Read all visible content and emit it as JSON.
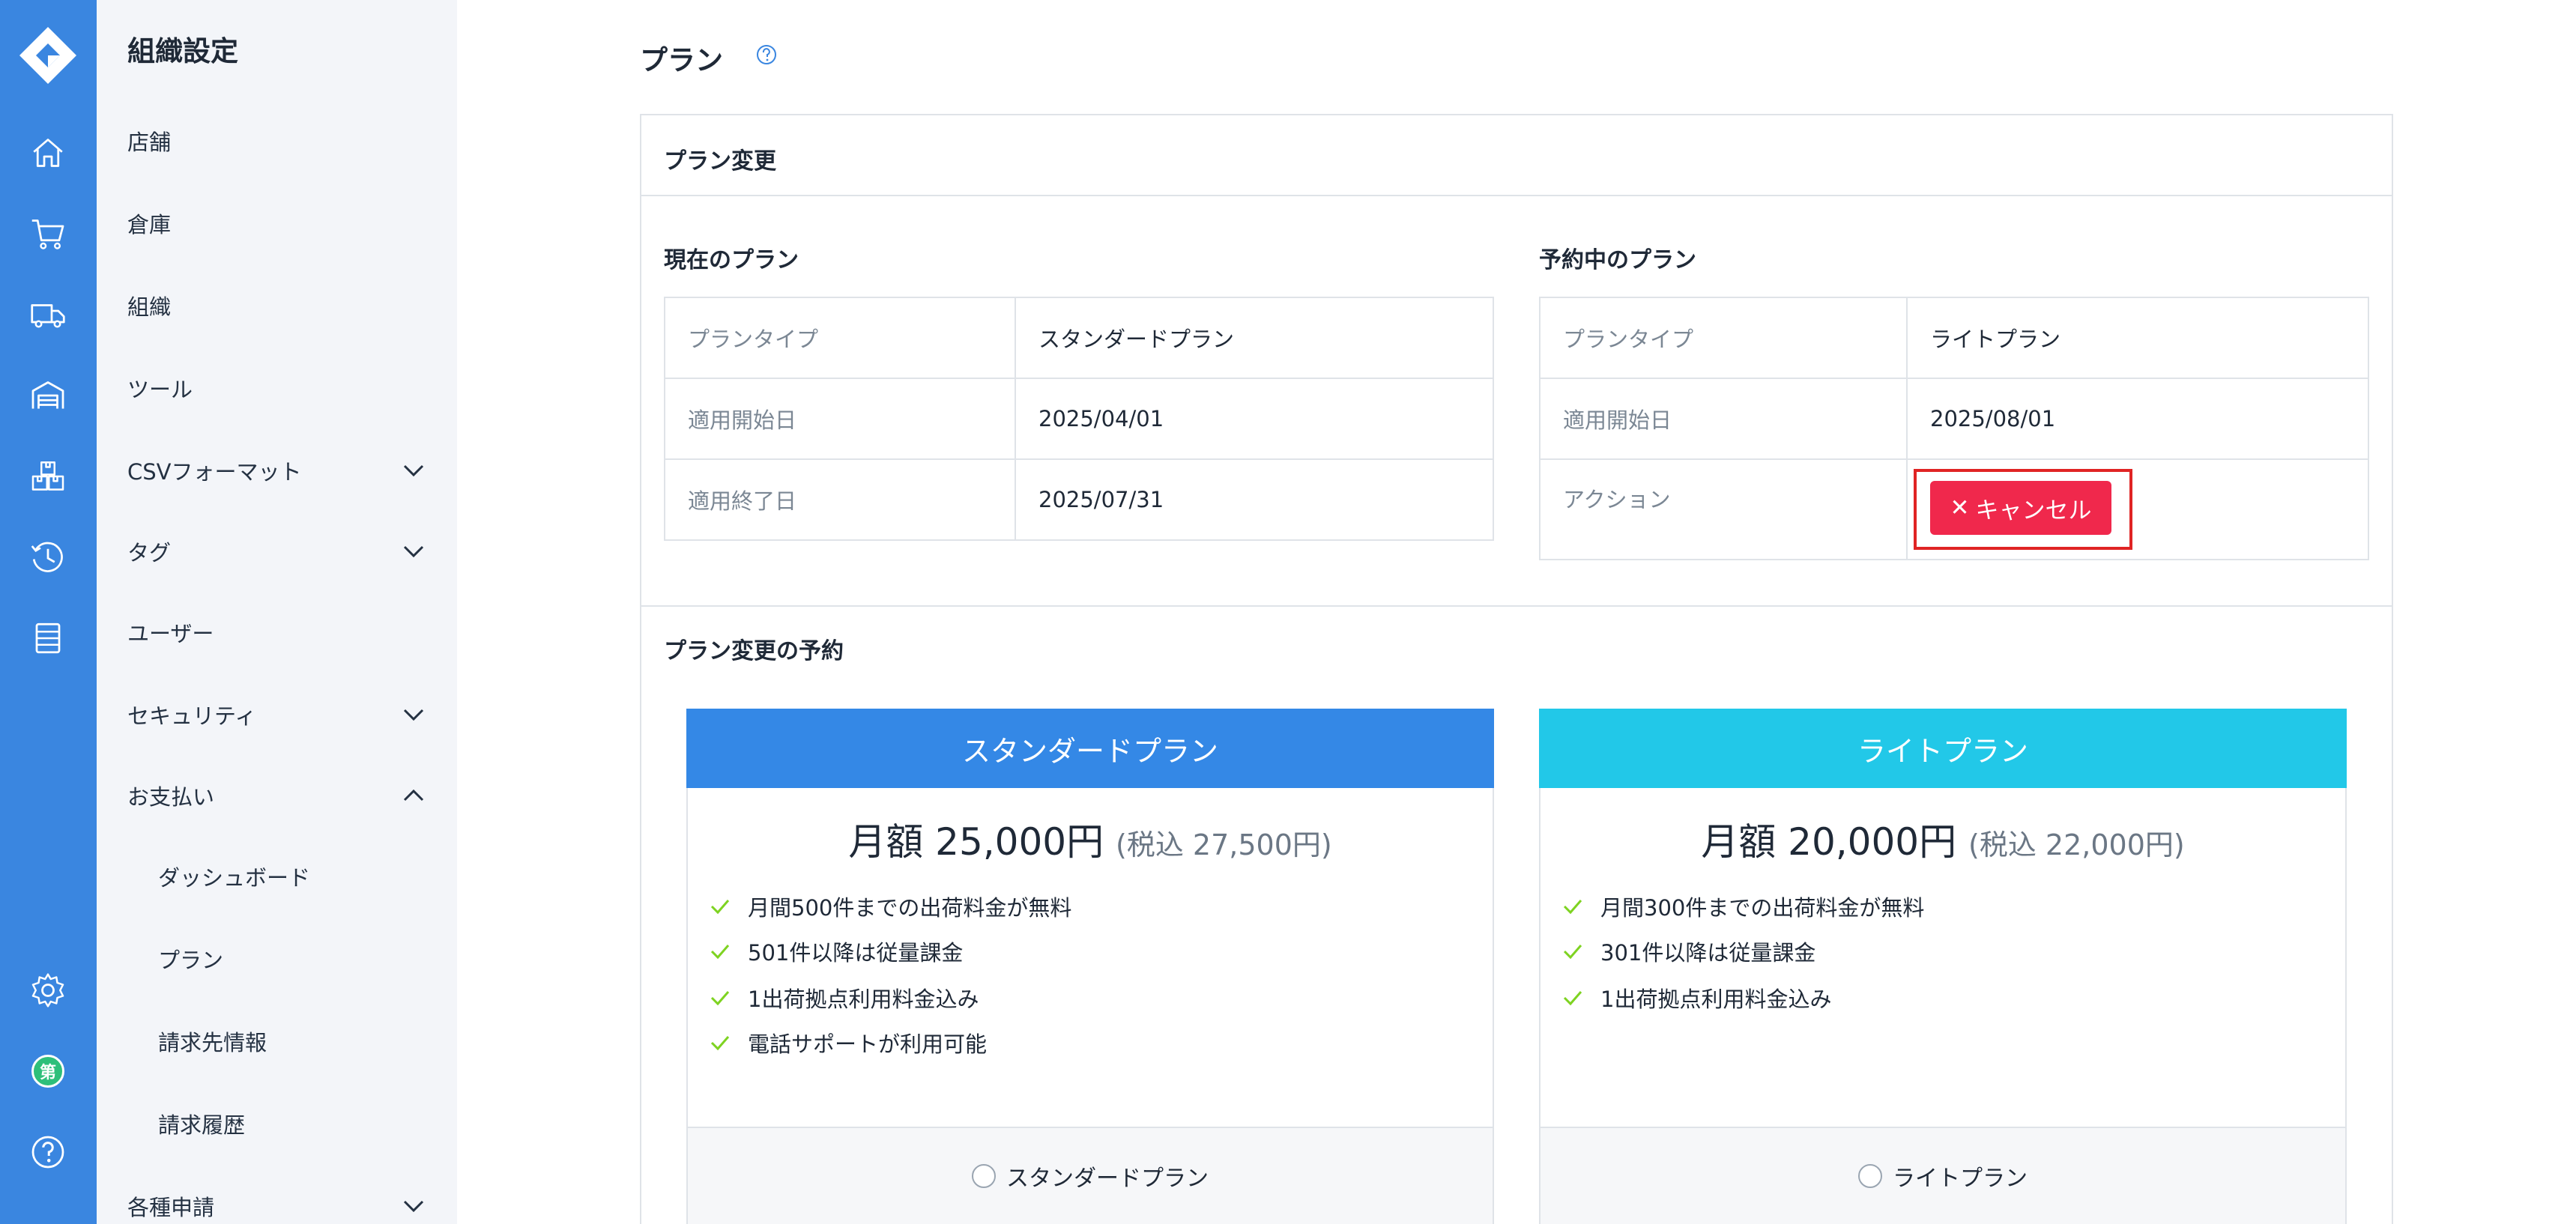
{
  "sidebar": {
    "title": "組織設定",
    "items": [
      {
        "label": "店舗"
      },
      {
        "label": "倉庫"
      },
      {
        "label": "組織"
      },
      {
        "label": "ツール"
      },
      {
        "label": "CSVフォーマット"
      },
      {
        "label": "タグ"
      },
      {
        "label": "ユーザー"
      },
      {
        "label": "セキュリティ"
      },
      {
        "label": "お支払い"
      },
      {
        "label": "ダッシュボード"
      },
      {
        "label": "プラン"
      },
      {
        "label": "請求先情報"
      },
      {
        "label": "請求履歴"
      },
      {
        "label": "各種申請"
      }
    ]
  },
  "rail": {
    "icons": [
      "home-icon",
      "cart-icon",
      "truck-icon",
      "warehouse-icon",
      "boxes-icon",
      "history-icon",
      "list-icon",
      "settings-icon",
      "org-badge-icon",
      "help-icon"
    ],
    "badge_text": "第"
  },
  "page": {
    "title": "プラン"
  },
  "plan_change": {
    "header": "プラン変更",
    "current": {
      "title": "現在のプラン",
      "rows": [
        {
          "key": "プランタイプ",
          "value": "スタンダードプラン"
        },
        {
          "key": "適用開始日",
          "value": "2025/04/01"
        },
        {
          "key": "適用終了日",
          "value": "2025/07/31"
        }
      ]
    },
    "reserved": {
      "title": "予約中のプラン",
      "rows": [
        {
          "key": "プランタイプ",
          "value": "ライトプラン"
        },
        {
          "key": "適用開始日",
          "value": "2025/08/01"
        },
        {
          "key": "アクション",
          "value": ""
        }
      ],
      "cancel_label": "キャンセル"
    }
  },
  "reservation": {
    "title": "プラン変更の予約",
    "plans": [
      {
        "name": "スタンダードプラン",
        "price": "月額 25,000円",
        "tax": "(税込 27,500円)",
        "features": [
          "月間500件までの出荷料金が無料",
          "501件以降は従量課金",
          "1出荷拠点利用料金込み",
          "電話サポートが利用可能"
        ],
        "radio_label": "スタンダードプラン",
        "color": "#3488e6"
      },
      {
        "name": "ライトプラン",
        "price": "月額 20,000円",
        "tax": "(税込 22,000円)",
        "features": [
          "月間300件までの出荷料金が無料",
          "301件以降は従量課金",
          "1出荷拠点利用料金込み"
        ],
        "radio_label": "ライトプラン",
        "color": "#22c8e8"
      }
    ]
  },
  "colors": {
    "rail": "#3a86e0",
    "subnav": "#f3f5f9",
    "cancel": "#f0284c",
    "check": "#7ed321",
    "highlight": "#e02424"
  }
}
